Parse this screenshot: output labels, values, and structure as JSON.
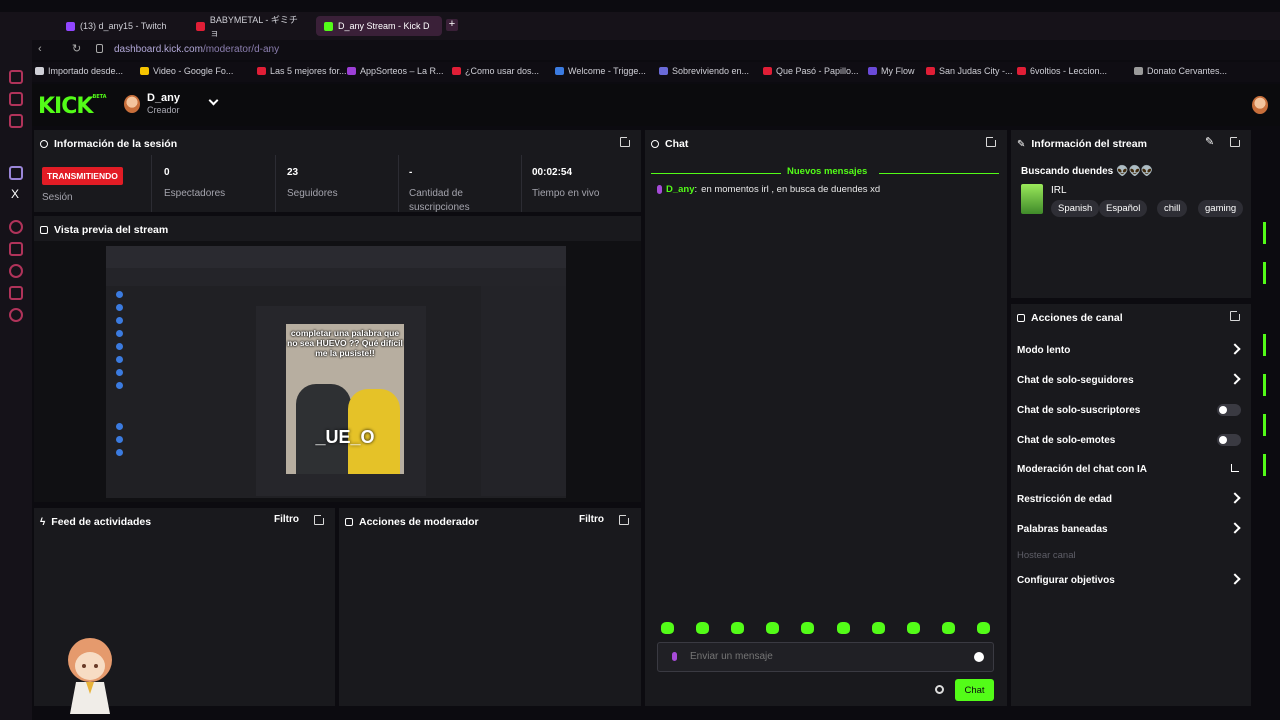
{
  "browser": {
    "tabs": [
      {
        "title": "(13) d_any15 - Twitch",
        "color": "#9146ff"
      },
      {
        "title": "BABYMETAL - ギミチョ",
        "color": "#e01e36"
      },
      {
        "title": "D_any Stream - Kick D",
        "color": "#53fc18"
      }
    ],
    "url_host": "dashboard.kick.com",
    "url_path": "/moderator/d-any",
    "bookmarks": [
      {
        "label": "Importado desde...",
        "color": "#cfcfd6"
      },
      {
        "label": "Video - Google Fo...",
        "color": "#f5c400"
      },
      {
        "label": "Las 5 mejores for...",
        "color": "#e01e36"
      },
      {
        "label": "AppSorteos – La R...",
        "color": "#9c3fd6"
      },
      {
        "label": "¿Como usar dos...",
        "color": "#e01e36"
      },
      {
        "label": "Welcome - Trigge...",
        "color": "#3b7be0"
      },
      {
        "label": "Sobreviviendo en...",
        "color": "#6a6ad8"
      },
      {
        "label": "Que Pasó - Papillo...",
        "color": "#e01e36"
      },
      {
        "label": "My Flow",
        "color": "#6a4ad8"
      },
      {
        "label": "San Judas City -...",
        "color": "#e01e36"
      },
      {
        "label": "6voltios - Leccion...",
        "color": "#e01e36"
      },
      {
        "label": "Donato Cervantes...",
        "color": "#9a9a9a"
      }
    ]
  },
  "header": {
    "logo": "KICK",
    "logo_badge": "BETA",
    "username": "D_any",
    "role": "Creador"
  },
  "session": {
    "title": "Información de la sesión",
    "live_badge": "TRANSMITIENDO",
    "session_label": "Sesión",
    "stats": [
      {
        "value": "0",
        "label": "Espectadores"
      },
      {
        "value": "23",
        "label": "Seguidores"
      },
      {
        "value": "-",
        "label": "Cantidad de suscripciones"
      },
      {
        "value": "00:02:54",
        "label": "Tiempo en vivo"
      }
    ]
  },
  "preview": {
    "title": "Vista previa del stream",
    "meme_top": "completar una palabra que no sea HUEVO ?? Qué difícil me la pusiste!!",
    "meme_bottom": "_UE_O"
  },
  "feed": {
    "title": "Feed de actividades",
    "filter": "Filtro"
  },
  "modactions": {
    "title": "Acciones de moderador",
    "filter": "Filtro"
  },
  "chat": {
    "title": "Chat",
    "new_messages": "Nuevos mensajes",
    "messages": [
      {
        "user": "D_any",
        "text": "en momentos irl , en busca de duendes xd"
      }
    ],
    "input_placeholder": "Enviar un mensaje",
    "send_label": "Chat"
  },
  "stream_info": {
    "title": "Información del stream",
    "stream_title": "Buscando duendes 👽👽👽",
    "category": "IRL",
    "tags": [
      "Spanish",
      "Español",
      "chill",
      "gaming"
    ]
  },
  "channel_actions": {
    "title": "Acciones de canal",
    "items": [
      {
        "label": "Modo lento",
        "control": "chevron"
      },
      {
        "label": "Chat de solo-seguidores",
        "control": "chevron"
      },
      {
        "label": "Chat de solo-suscriptores",
        "control": "toggle",
        "on": false
      },
      {
        "label": "Chat de solo-emotes",
        "control": "toggle",
        "on": false
      },
      {
        "label": "Moderación del chat con IA",
        "control": "external"
      },
      {
        "label": "Restricción de edad",
        "control": "chevron"
      },
      {
        "label": "Palabras baneadas",
        "control": "chevron"
      },
      {
        "label": "Hostear canal",
        "control": "none",
        "disabled": true
      },
      {
        "label": "Configurar objetivos",
        "control": "chevron"
      }
    ]
  },
  "colors": {
    "accent": "#53fc18",
    "live": "#e21c25",
    "panel": "#19191d"
  }
}
